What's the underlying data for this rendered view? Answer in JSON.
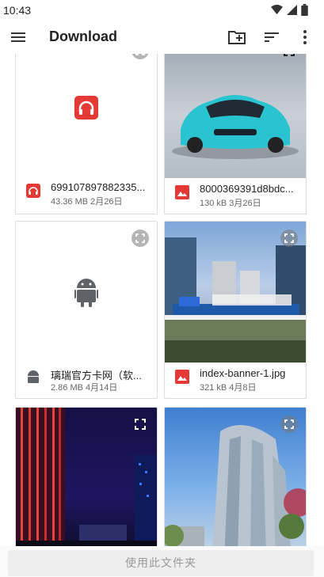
{
  "status_bar": {
    "time": "10:43",
    "icons": [
      "wifi-icon",
      "signal-icon",
      "battery-icon"
    ]
  },
  "app_bar": {
    "title": "Download",
    "actions": [
      "new-folder-icon",
      "sort-icon",
      "more-vert-icon"
    ]
  },
  "files": [
    {
      "name": "699107897882335...",
      "meta": "43.36 MB 2月26日",
      "kind": "audio",
      "thumbnail": "headphones-app-icon",
      "expand": false
    },
    {
      "name": "8000369391d8bdc...",
      "meta": "130 kB 3月26日",
      "kind": "image",
      "thumbnail": "car-photo",
      "expand": true
    },
    {
      "name": "璃瑞官方卡网（软...",
      "meta": "2.86 MB 4月14日",
      "kind": "android",
      "thumbnail": "android-robot-icon",
      "expand": false
    },
    {
      "name": "index-banner-1.jpg",
      "meta": "321 kB 4月8日",
      "kind": "image",
      "thumbnail": "building-sign-photo",
      "expand": true
    },
    {
      "name": "",
      "meta": "",
      "kind": "image",
      "thumbnail": "night-building-photo",
      "expand": true
    },
    {
      "name": "",
      "meta": "",
      "kind": "image",
      "thumbnail": "glass-tower-photo",
      "expand": true
    }
  ],
  "colors": {
    "accent_red": "#e53935",
    "android_gray": "#5f6368",
    "car_cyan": "#29c4d0"
  },
  "bottom": {
    "use_folder_label": "使用此文件夹"
  }
}
